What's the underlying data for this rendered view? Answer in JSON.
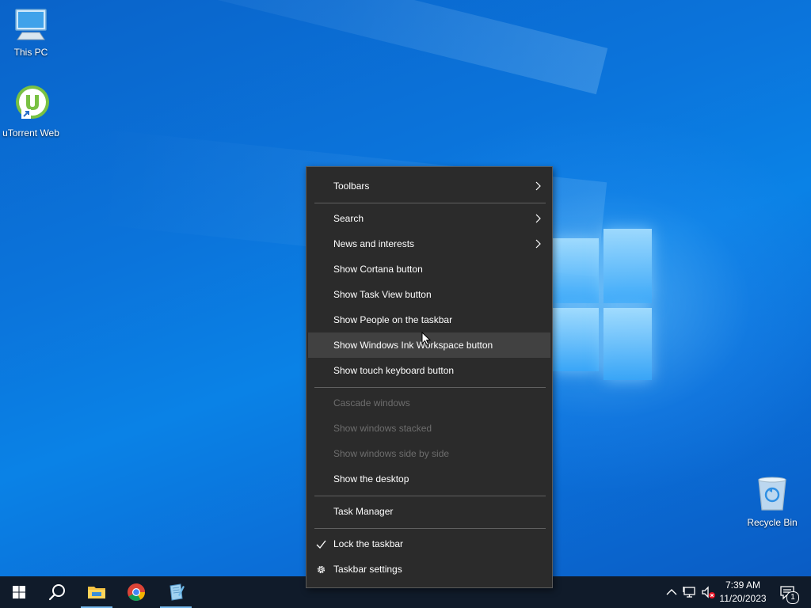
{
  "desktop": {
    "icons": [
      {
        "label": "This PC",
        "icon": "computer-icon"
      },
      {
        "label": "uTorrent Web",
        "icon": "utorrent-icon"
      },
      {
        "label": "Recycle Bin",
        "icon": "recycle-bin-icon"
      }
    ]
  },
  "context_menu": {
    "items": [
      {
        "label": "Toolbars",
        "has_submenu": true
      },
      {
        "label": "Search",
        "has_submenu": true
      },
      {
        "label": "News and interests",
        "has_submenu": true
      },
      {
        "label": "Show Cortana button"
      },
      {
        "label": "Show Task View button"
      },
      {
        "label": "Show People on the taskbar"
      },
      {
        "label": "Show Windows Ink Workspace button",
        "hovered": true
      },
      {
        "label": "Show touch keyboard button"
      },
      {
        "label": "Cascade windows",
        "disabled": true
      },
      {
        "label": "Show windows stacked",
        "disabled": true
      },
      {
        "label": "Show windows side by side",
        "disabled": true
      },
      {
        "label": "Show the desktop"
      },
      {
        "label": "Task Manager"
      },
      {
        "label": "Lock the taskbar",
        "checked": true
      },
      {
        "label": "Taskbar settings",
        "icon": "gear-icon"
      }
    ]
  },
  "taskbar": {
    "buttons": [
      {
        "name": "start",
        "icon": "windows-logo-icon"
      },
      {
        "name": "search",
        "icon": "search-icon"
      },
      {
        "name": "file-explorer",
        "icon": "folder-icon"
      },
      {
        "name": "chrome",
        "icon": "chrome-icon"
      },
      {
        "name": "notepad",
        "icon": "notepad-icon"
      }
    ],
    "clock": {
      "time": "7:39 AM",
      "date": "11/20/2023"
    },
    "notification_count": "1"
  },
  "colors": {
    "menu_bg": "#2b2b2b",
    "menu_hover": "#414141",
    "taskbar_bg": "#101b2a",
    "accent": "#76b9ed"
  }
}
